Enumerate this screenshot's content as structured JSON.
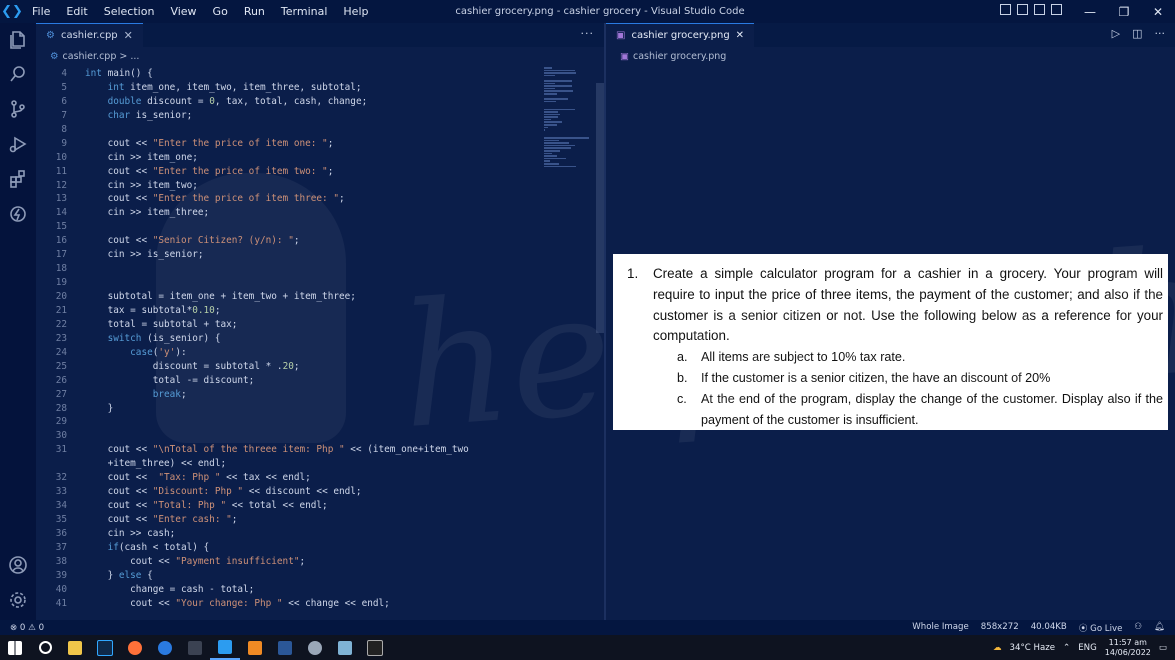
{
  "titlebar": {
    "menu": [
      "File",
      "Edit",
      "Selection",
      "View",
      "Go",
      "Run",
      "Terminal",
      "Help"
    ],
    "title": "cashier grocery.png - cashier grocery - Visual Studio Code",
    "minimize": "—",
    "maximize": "❐",
    "close": "✕"
  },
  "left_editor": {
    "tab_label": "cashier.cpp",
    "tab_icon": "C++",
    "breadcrumb": "cashier.cpp > ...",
    "code": [
      {
        "n": "4",
        "t": "int main() {"
      },
      {
        "n": "5",
        "t": "    int item_one, item_two, item_three, subtotal;"
      },
      {
        "n": "6",
        "t": "    double discount = 0, tax, total, cash, change;"
      },
      {
        "n": "7",
        "t": "    char is_senior;"
      },
      {
        "n": "8",
        "t": ""
      },
      {
        "n": "9",
        "t": "    cout << \"Enter the price of item one: \";"
      },
      {
        "n": "10",
        "t": "    cin >> item_one;"
      },
      {
        "n": "11",
        "t": "    cout << \"Enter the price of item two: \";"
      },
      {
        "n": "12",
        "t": "    cin >> item_two;"
      },
      {
        "n": "13",
        "t": "    cout << \"Enter the price of item three: \";"
      },
      {
        "n": "14",
        "t": "    cin >> item_three;"
      },
      {
        "n": "15",
        "t": ""
      },
      {
        "n": "16",
        "t": "    cout << \"Senior Citizen? (y/n): \";"
      },
      {
        "n": "17",
        "t": "    cin >> is_senior;"
      },
      {
        "n": "18",
        "t": ""
      },
      {
        "n": "19",
        "t": ""
      },
      {
        "n": "20",
        "t": "    subtotal = item_one + item_two + item_three;"
      },
      {
        "n": "21",
        "t": "    tax = subtotal*0.10;"
      },
      {
        "n": "22",
        "t": "    total = subtotal + tax;"
      },
      {
        "n": "23",
        "t": "    switch (is_senior) {"
      },
      {
        "n": "24",
        "t": "        case('y'):"
      },
      {
        "n": "25",
        "t": "            discount = subtotal * .20;"
      },
      {
        "n": "26",
        "t": "            total -= discount;"
      },
      {
        "n": "27",
        "t": "            break;"
      },
      {
        "n": "28",
        "t": "    }"
      },
      {
        "n": "29",
        "t": ""
      },
      {
        "n": "30",
        "t": ""
      },
      {
        "n": "31",
        "t": "    cout << \"\\nTotal of the threee item: Php \" << (item_one+item_two"
      },
      {
        "n": "",
        "t": "    +item_three) << endl;"
      },
      {
        "n": "32",
        "t": "    cout <<  \"Tax: Php \" << tax << endl;"
      },
      {
        "n": "33",
        "t": "    cout << \"Discount: Php \" << discount << endl;"
      },
      {
        "n": "34",
        "t": "    cout << \"Total: Php \" << total << endl;"
      },
      {
        "n": "35",
        "t": "    cout << \"Enter cash: \";"
      },
      {
        "n": "36",
        "t": "    cin >> cash;"
      },
      {
        "n": "37",
        "t": "    if(cash < total) {"
      },
      {
        "n": "38",
        "t": "        cout << \"Payment insufficient\";"
      },
      {
        "n": "39",
        "t": "    } else {"
      },
      {
        "n": "40",
        "t": "        change = cash - total;"
      },
      {
        "n": "41",
        "t": "        cout << \"Your change: Php \" << change << endl;"
      }
    ]
  },
  "right_editor": {
    "tab_label": "cashier grocery.png",
    "breadcrumb": "cashier grocery.png",
    "paper": {
      "number": "1.",
      "question": "Create a simple calculator program for a cashier in a grocery. Your program will require to input the price of three items, the payment of the customer; and also if the customer is a senior citizen or not. Use the following below as a reference for your computation.",
      "items": [
        {
          "label": "a.",
          "text": "All items are subject to 10% tax rate."
        },
        {
          "label": "b.",
          "text": "If the customer is a senior citizen, the have an discount of 20%"
        },
        {
          "label": "c.",
          "text": "At the end of the program, display the change of the customer. Display also if the payment of the customer is insufficient."
        }
      ]
    }
  },
  "statusbar": {
    "problems": "⊗ 0 ⚠ 0",
    "whole_image": "Whole Image",
    "dimensions": "858x272",
    "size": "40.04KB",
    "go_live": "Go Live"
  },
  "taskbar": {
    "weather": "34°C  Haze",
    "lang": "ENG",
    "time": "11:57 am",
    "date": "14/06/2022"
  },
  "watermark": "helping hand"
}
